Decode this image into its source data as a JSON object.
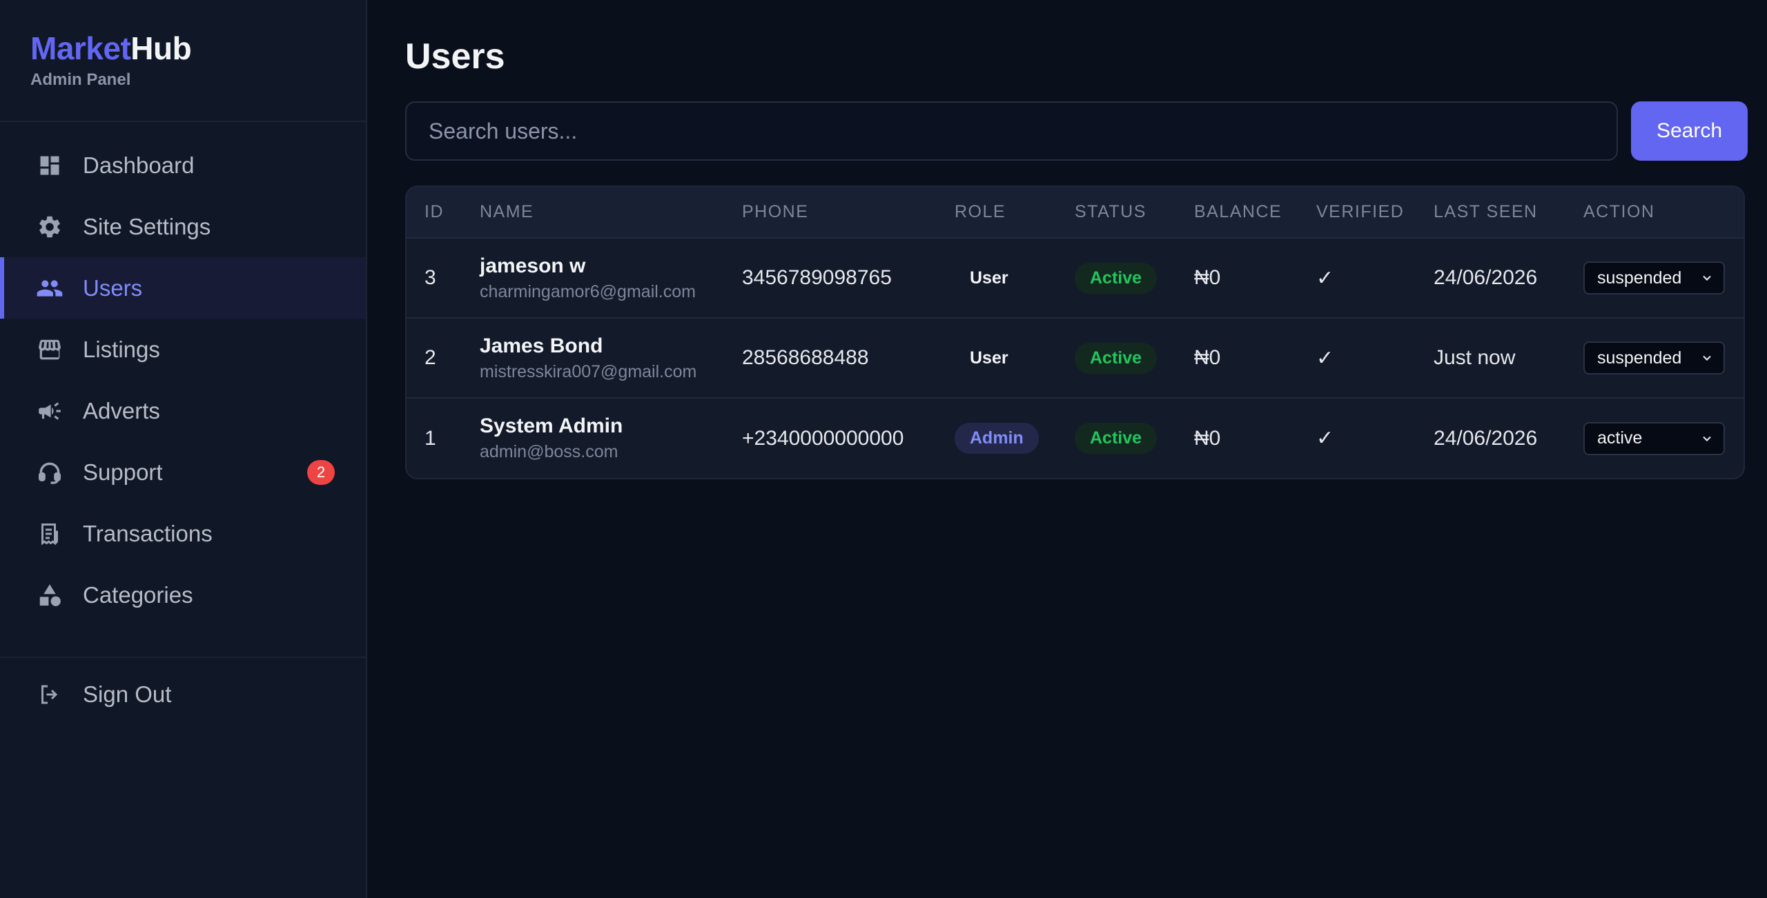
{
  "brand": {
    "name_part1": "Market",
    "name_part2": "Hub",
    "subtitle": "Admin Panel"
  },
  "sidebar": {
    "items": [
      {
        "label": "Dashboard",
        "icon": "dashboard-icon"
      },
      {
        "label": "Site Settings",
        "icon": "gear-icon"
      },
      {
        "label": "Users",
        "icon": "users-icon",
        "active": true
      },
      {
        "label": "Listings",
        "icon": "store-icon"
      },
      {
        "label": "Adverts",
        "icon": "megaphone-icon"
      },
      {
        "label": "Support",
        "icon": "headset-icon",
        "badge": "2"
      },
      {
        "label": "Transactions",
        "icon": "receipt-icon"
      },
      {
        "label": "Categories",
        "icon": "shapes-icon"
      }
    ],
    "signout": {
      "label": "Sign Out",
      "icon": "sign-out-icon"
    }
  },
  "main": {
    "title": "Users",
    "search": {
      "placeholder": "Search users...",
      "value": "",
      "button_label": "Search"
    },
    "table": {
      "headers": [
        "ID",
        "NAME",
        "PHONE",
        "ROLE",
        "STATUS",
        "BALANCE",
        "VERIFIED",
        "LAST SEEN",
        "ACTION"
      ],
      "rows": [
        {
          "id": "3",
          "name": "jameson w",
          "email": "charmingamor6@gmail.com",
          "phone": "3456789098765",
          "role": "User",
          "status": "Active",
          "balance": "₦0",
          "verified": "✓",
          "last_seen": "24/06/2026",
          "action": "suspended"
        },
        {
          "id": "2",
          "name": "James Bond",
          "email": "mistresskira007@gmail.com",
          "phone": "28568688488",
          "role": "User",
          "status": "Active",
          "balance": "₦0",
          "verified": "✓",
          "last_seen": "Just now",
          "action": "suspended"
        },
        {
          "id": "1",
          "name": "System Admin",
          "email": "admin@boss.com",
          "phone": "+2340000000000",
          "role": "Admin",
          "status": "Active",
          "balance": "₦0",
          "verified": "✓",
          "last_seen": "24/06/2026",
          "action": "active"
        }
      ]
    }
  },
  "colors": {
    "accent": "#6366f1",
    "active_status": "#22c55e",
    "badge": "#ef4444",
    "background": "#0a0f1c",
    "sidebar": "#101727"
  }
}
